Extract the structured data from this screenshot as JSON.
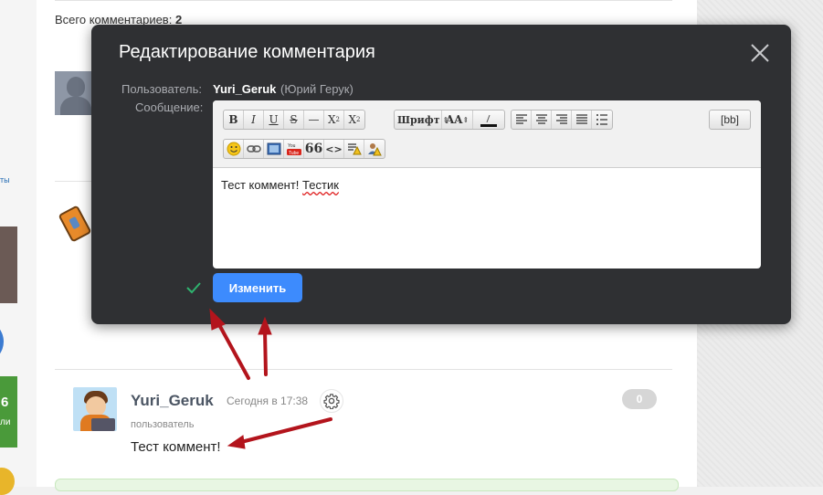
{
  "page": {
    "total_label": "Всего комментариев:",
    "total_count": "2",
    "side_link_text": "ты",
    "side_number": "6",
    "side_text": "ли"
  },
  "modal": {
    "title": "Редактирование комментария",
    "user_label": "Пользователь:",
    "username": "Yuri_Geruk",
    "real_name": "(Юрий Герук)",
    "message_label": "Сообщение:",
    "toolbar": {
      "row1": [
        {
          "name": "bold-button",
          "label": "B"
        },
        {
          "name": "italic-button",
          "label": "I"
        },
        {
          "name": "underline-button",
          "label": "U"
        },
        {
          "name": "strike-button",
          "label": "S"
        },
        {
          "name": "hr-button",
          "label": "—"
        }
      ],
      "font_label": "Шрифт",
      "size_label": "AA",
      "bb_label": "[bb]",
      "quote_label": "66",
      "code_label": "<>",
      "youtube_label": "You Tube"
    },
    "message_text": "Тест коммент! ",
    "message_text_misspelled": "Тестик",
    "submit_label": "Изменить"
  },
  "comment": {
    "username": "Yuri_Geruk",
    "time": "Сегодня в 17:38",
    "role": "пользователь",
    "text": "Тест коммент!",
    "rating": "0"
  },
  "colors": {
    "modal_bg": "#2f3033",
    "submit": "#3d8bfd",
    "arrow": "#b3141c",
    "check": "#2fb36f"
  }
}
